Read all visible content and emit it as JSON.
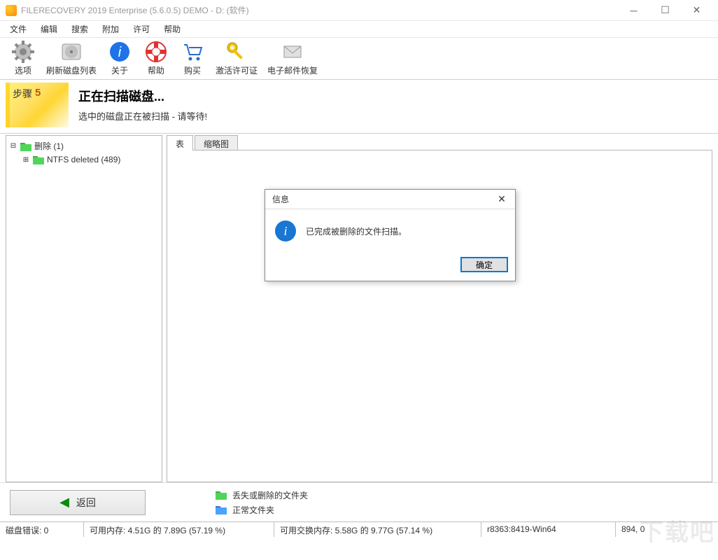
{
  "window": {
    "title": "FILERECOVERY 2019 Enterprise (5.6.0.5) DEMO - D: (软件)"
  },
  "menu": {
    "file": "文件",
    "edit": "编辑",
    "search": "搜索",
    "extra": "附加",
    "license": "许可",
    "help": "帮助"
  },
  "toolbar": {
    "options": "选项",
    "refresh": "刷新磁盘列表",
    "about": "关于",
    "help": "帮助",
    "buy": "购买",
    "activate": "激活许可证",
    "email": "电子邮件恢复"
  },
  "step": {
    "label": "步骤",
    "number": "5",
    "heading": "正在扫描磁盘...",
    "sub": "选中的磁盘正在被扫描 - 请等待!"
  },
  "tree": {
    "root": "删除 (1)",
    "child": "NTFS deleted (489)"
  },
  "tabs": {
    "table": "表",
    "thumb": "缩略图"
  },
  "dialog": {
    "title": "信息",
    "message": "已完成被删除的文件扫描。",
    "ok": "确定"
  },
  "bottom": {
    "back": "返回",
    "legend1": "丢失或删除的文件夹",
    "legend2": "正常文件夹"
  },
  "status": {
    "err": "磁盘错误: 0",
    "mem": "可用内存: 4.51G 的 7.89G (57.19 %)",
    "swap": "可用交换内存: 5.58G 的 9.77G (57.14 %)",
    "build": "r8363:8419-Win64",
    "pos": "894, 0"
  },
  "watermark": "下载吧"
}
